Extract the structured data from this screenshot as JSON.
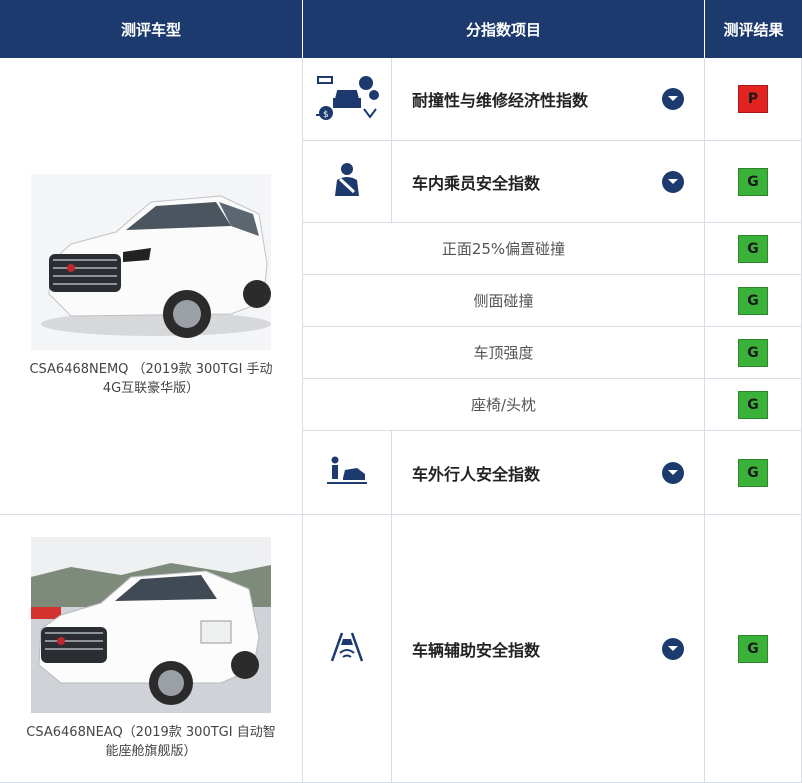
{
  "header": {
    "col_model": "测评车型",
    "col_items": "分指数项目",
    "col_result": "测评结果"
  },
  "colors": {
    "header_bg": "#1c3a6e",
    "good": "#3ab23a",
    "poor": "#e32222",
    "border": "#d7dde6"
  },
  "cars": [
    {
      "caption": "CSA6468NEMQ （2019款 300TGI 手动4G互联豪华版）"
    },
    {
      "caption": "CSA6468NEAQ（2019款 300TGI 自动智能座舱旗舰版）"
    }
  ],
  "rows": [
    {
      "icon": "repair-cost-icon",
      "label": "耐撞性与维修经济性指数",
      "result": "P"
    },
    {
      "icon": "occupant-seatbelt-icon",
      "label": "车内乘员安全指数",
      "result": "G"
    },
    {
      "label": "正面25%偏置碰撞",
      "result": "G"
    },
    {
      "label": "侧面碰撞",
      "result": "G"
    },
    {
      "label": "车顶强度",
      "result": "G"
    },
    {
      "label": "座椅/头枕",
      "result": "G"
    },
    {
      "icon": "pedestrian-icon",
      "label": "车外行人安全指数",
      "result": "G"
    },
    {
      "icon": "driver-assist-icon",
      "label": "车辆辅助安全指数",
      "result": "G"
    }
  ]
}
